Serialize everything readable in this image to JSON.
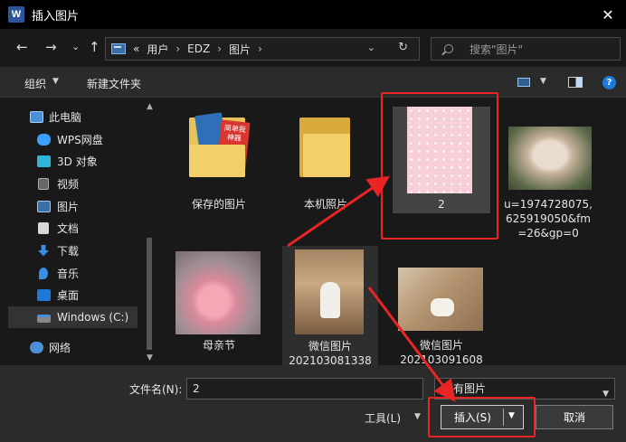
{
  "titlebar": {
    "app_icon": "W",
    "title": "插入图片",
    "close_glyph": "✕"
  },
  "nav_buttons": {
    "back": "←",
    "forward": "→",
    "recent_caret": "⌄",
    "up": "↑"
  },
  "address": {
    "overflow": "«",
    "crumbs": [
      "用户",
      "EDZ",
      "图片"
    ],
    "sep": "›",
    "dropdown_glyph": "⌄",
    "refresh_glyph": "↻"
  },
  "search": {
    "placeholder": "搜索\"图片\""
  },
  "toolbar": {
    "organize": "组织",
    "caret": "▼",
    "new_folder": "新建文件夹",
    "help": "?"
  },
  "nav_pane": {
    "items": [
      {
        "label": "此电脑",
        "icon": "computer-icon"
      },
      {
        "label": "WPS网盘",
        "icon": "cloud-icon"
      },
      {
        "label": "3D 对象",
        "icon": "cube-icon"
      },
      {
        "label": "视频",
        "icon": "video-icon"
      },
      {
        "label": "图片",
        "icon": "picture-icon"
      },
      {
        "label": "文档",
        "icon": "document-icon"
      },
      {
        "label": "下载",
        "icon": "download-icon"
      },
      {
        "label": "音乐",
        "icon": "music-icon"
      },
      {
        "label": "桌面",
        "icon": "desktop-icon"
      },
      {
        "label": "Windows (C:)",
        "icon": "drive-icon"
      },
      {
        "label": "网络",
        "icon": "network-icon"
      }
    ],
    "selected": "Windows (C:)",
    "scroll_up": "▲",
    "scroll_down": "▼"
  },
  "files": [
    {
      "name": "保存的图片",
      "kind": "folder"
    },
    {
      "name": "本机照片",
      "kind": "folder"
    },
    {
      "name": "2",
      "kind": "image",
      "selected": true
    },
    {
      "name_lines": [
        "u=1974728075,",
        "625919050&fm",
        "=26&gp=0"
      ],
      "kind": "image"
    },
    {
      "name": "母亲节",
      "kind": "image"
    },
    {
      "name_lines": [
        "微信图片",
        "202103081338"
      ],
      "kind": "image"
    },
    {
      "name_lines": [
        "微信图片",
        "202103091608"
      ],
      "kind": "image"
    }
  ],
  "folder_thumb_text": "简单我 神器",
  "bottom": {
    "filename_label": "文件名(N):",
    "filename_value": "2",
    "filetype": "所有图片",
    "tools": "工具(L)",
    "insert": "插入(S)",
    "cancel": "取消"
  },
  "colors": {
    "accent_red": "#e82424",
    "selection": "#444444",
    "dialog_bg": "#191919"
  }
}
